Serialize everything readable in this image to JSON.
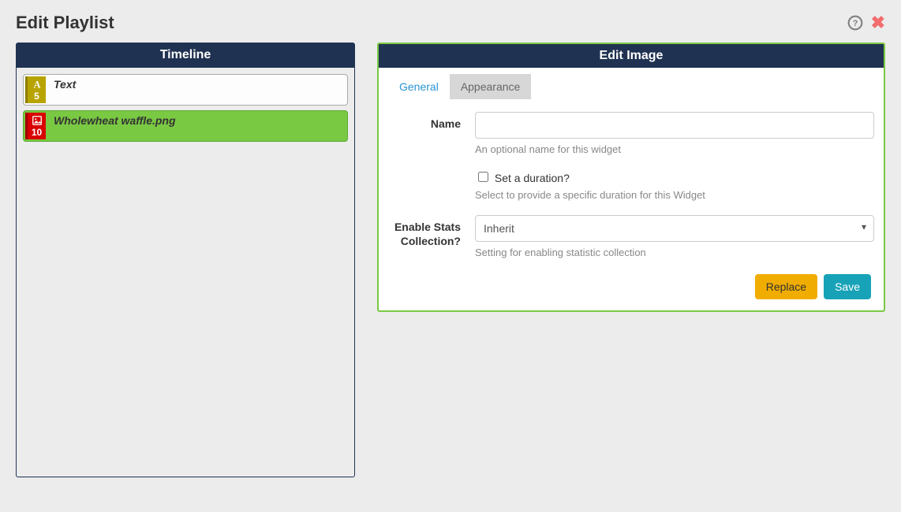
{
  "modal": {
    "title": "Edit Playlist"
  },
  "timeline": {
    "header": "Timeline",
    "items": [
      {
        "type": "text",
        "duration": "5",
        "label": "Text",
        "selected": false
      },
      {
        "type": "image",
        "duration": "10",
        "label": "Wholewheat waffle.png",
        "selected": true
      }
    ]
  },
  "edit": {
    "header": "Edit Image",
    "tabs": {
      "general": "General",
      "appearance": "Appearance"
    },
    "form": {
      "name_label": "Name",
      "name_value": "",
      "name_help": "An optional name for this widget",
      "duration_checkbox_label": "Set a duration?",
      "duration_help": "Select to provide a specific duration for this Widget",
      "stats_label": "Enable Stats Collection?",
      "stats_value": "Inherit",
      "stats_help": "Setting for enabling statistic collection"
    },
    "buttons": {
      "replace": "Replace",
      "save": "Save"
    }
  }
}
